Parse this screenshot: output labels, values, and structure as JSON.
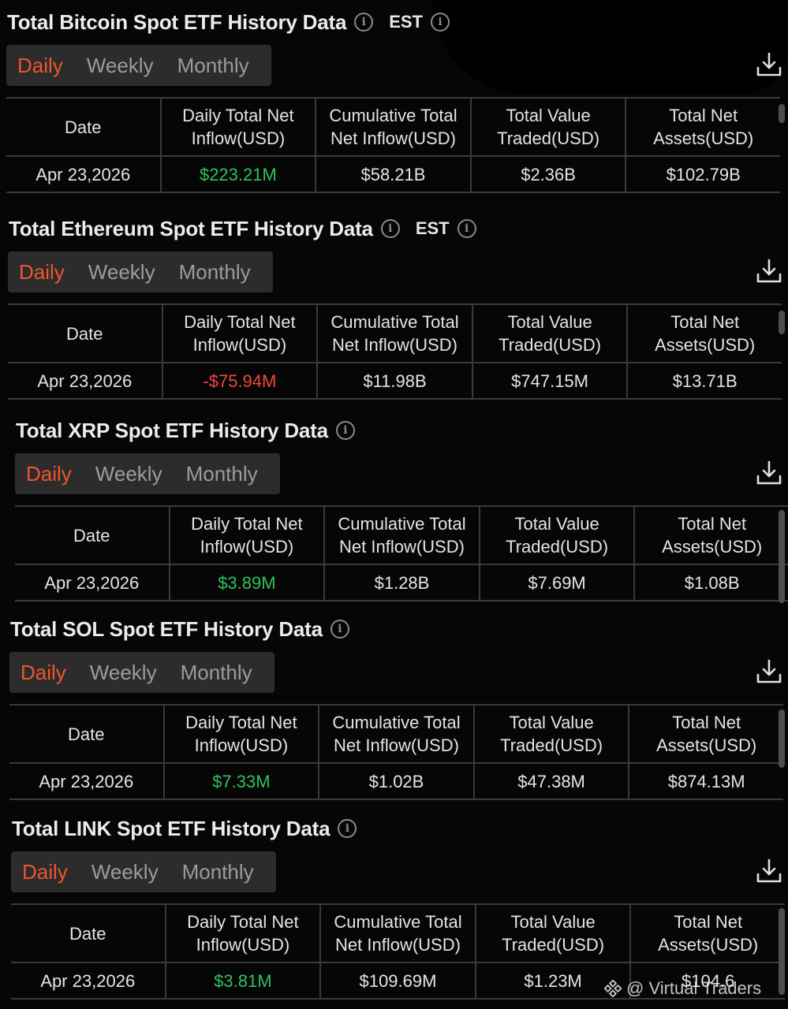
{
  "sections": [
    {
      "title": "Total Bitcoin Spot ETF History Data",
      "timezone": "EST",
      "tabs": [
        "Daily",
        "Weekly",
        "Monthly"
      ],
      "active_tab": "Daily",
      "headers": [
        "Date",
        "Daily Total Net Inflow(USD)",
        "Cumulative Total Net Inflow(USD)",
        "Total Value Traded(USD)",
        "Total Net Assets(USD)"
      ],
      "row": [
        "Apr 23,2026",
        "$223.21M",
        "$58.21B",
        "$2.36B",
        "$102.79B"
      ],
      "inflow_sign": "positive"
    },
    {
      "title": "Total Ethereum Spot ETF History Data",
      "timezone": "EST",
      "tabs": [
        "Daily",
        "Weekly",
        "Monthly"
      ],
      "active_tab": "Daily",
      "headers": [
        "Date",
        "Daily Total Net Inflow(USD)",
        "Cumulative Total Net Inflow(USD)",
        "Total Value Traded(USD)",
        "Total Net Assets(USD)"
      ],
      "row": [
        "Apr 23,2026",
        "-$75.94M",
        "$11.98B",
        "$747.15M",
        "$13.71B"
      ],
      "inflow_sign": "negative"
    },
    {
      "title": "Total XRP Spot ETF History Data",
      "timezone": "",
      "tabs": [
        "Daily",
        "Weekly",
        "Monthly"
      ],
      "active_tab": "Daily",
      "headers": [
        "Date",
        "Daily Total Net Inflow(USD)",
        "Cumulative Total Net Inflow(USD)",
        "Total Value Traded(USD)",
        "Total Net Assets(USD)"
      ],
      "row": [
        "Apr 23,2026",
        "$3.89M",
        "$1.28B",
        "$7.69M",
        "$1.08B"
      ],
      "inflow_sign": "positive"
    },
    {
      "title": "Total SOL Spot ETF History Data",
      "timezone": "",
      "tabs": [
        "Daily",
        "Weekly",
        "Monthly"
      ],
      "active_tab": "Daily",
      "headers": [
        "Date",
        "Daily Total Net Inflow(USD)",
        "Cumulative Total Net Inflow(USD)",
        "Total Value Traded(USD)",
        "Total Net Assets(USD)"
      ],
      "row": [
        "Apr 23,2026",
        "$7.33M",
        "$1.02B",
        "$47.38M",
        "$874.13M"
      ],
      "inflow_sign": "positive"
    },
    {
      "title": "Total LINK Spot ETF History Data",
      "timezone": "",
      "tabs": [
        "Daily",
        "Weekly",
        "Monthly"
      ],
      "active_tab": "Daily",
      "headers": [
        "Date",
        "Daily Total Net Inflow(USD)",
        "Cumulative Total Net Inflow(USD)",
        "Total Value Traded(USD)",
        "Total Net Assets(USD)"
      ],
      "row": [
        "Apr 23,2026",
        "$3.81M",
        "$109.69M",
        "$1.23M",
        "$104.6"
      ],
      "inflow_sign": "positive"
    }
  ],
  "colors": {
    "active_tab": "#f0552c",
    "positive": "#2fc25b",
    "negative": "#f2463c"
  },
  "icons": {
    "info": "info-circle-icon",
    "download": "download-icon",
    "watermark_logo": "binance-logo-icon"
  },
  "watermark": {
    "text": "@ Virtual Traders"
  }
}
